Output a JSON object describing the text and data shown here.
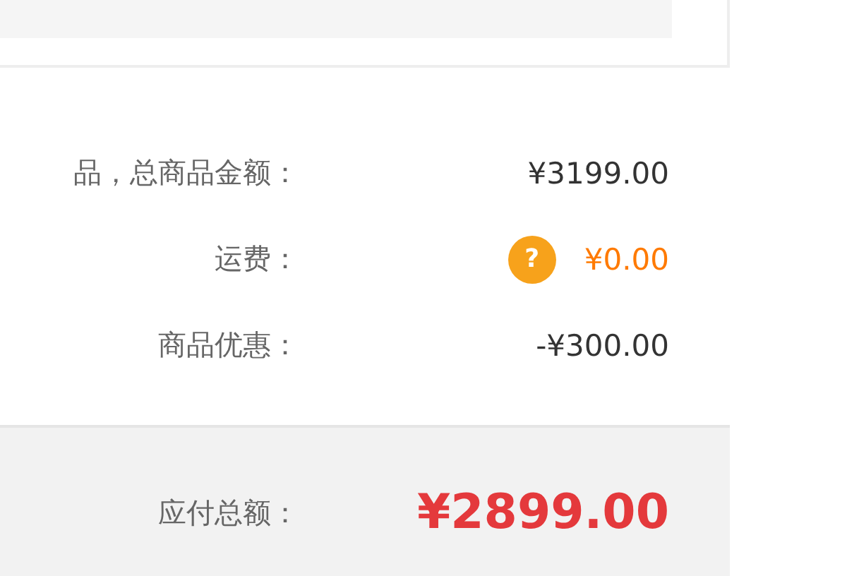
{
  "summary": {
    "rows": [
      {
        "label": "品，总商品金额：",
        "value": "¥3199.00",
        "highlight": false
      },
      {
        "label": "运费：",
        "value": "¥0.00",
        "highlight": true,
        "help_icon": "?"
      },
      {
        "label": "商品优惠：",
        "value": "-¥300.00",
        "highlight": false
      }
    ]
  },
  "total": {
    "label": "应付总额：",
    "value": "¥2899.00"
  }
}
